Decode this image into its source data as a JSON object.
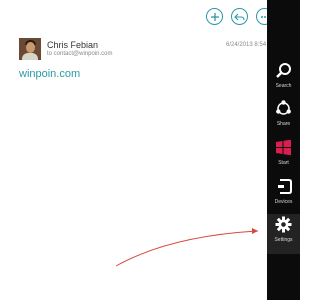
{
  "email": {
    "sender": "Chris Febian",
    "to": "to contact@winpoin.com",
    "date": "6/24/2013  8:54",
    "body": "winpoin.com"
  },
  "toolbar": {
    "icons": [
      "new-icon",
      "reply-icon",
      "more-icon"
    ]
  },
  "charms": [
    {
      "label": "Search",
      "icon": "search-icon"
    },
    {
      "label": "Share",
      "icon": "share-icon"
    },
    {
      "label": "Start",
      "icon": "windows-logo-icon"
    },
    {
      "label": "Devices",
      "icon": "devices-icon"
    },
    {
      "label": "Settings",
      "icon": "gear-icon"
    }
  ],
  "colors": {
    "accent": "#2a9aa6",
    "charm_bar": "#0b0b0b",
    "start_tile": "#d81f4f",
    "annotation_arrow": "#d9473c"
  }
}
